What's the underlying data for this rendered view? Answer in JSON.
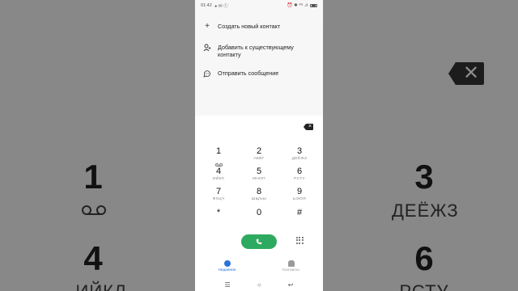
{
  "status_bar": {
    "time": "01:42",
    "left_extra": "▸ ✉ ⓣ",
    "right_icons": "⏰ ✱ ⁴ᴳ .ıl"
  },
  "menu": {
    "items": [
      {
        "label": "Создать новый контакт",
        "icon": "plus-icon"
      },
      {
        "label": "Добавить к существующему контакту",
        "icon": "add-person-icon"
      },
      {
        "label": "Отправить сообщение",
        "icon": "message-icon"
      }
    ]
  },
  "keypad": {
    "keys": [
      {
        "digit": "1",
        "sub": "",
        "voicemail": true
      },
      {
        "digit": "2",
        "sub": "АБВГ"
      },
      {
        "digit": "3",
        "sub": "ДЕЁЖЗ"
      },
      {
        "digit": "4",
        "sub": "ИЙКЛ"
      },
      {
        "digit": "5",
        "sub": "МНОП"
      },
      {
        "digit": "6",
        "sub": "РСТУ"
      },
      {
        "digit": "7",
        "sub": "ФХЦЧ"
      },
      {
        "digit": "8",
        "sub": "ШЩЪЫ"
      },
      {
        "digit": "9",
        "sub": "ЬЭЮЯ"
      },
      {
        "digit": "*",
        "sub": ""
      },
      {
        "digit": "0",
        "sub": ""
      },
      {
        "digit": "#",
        "sub": ""
      }
    ]
  },
  "tabs": {
    "recent": "Недавние",
    "contacts": "Контакты"
  },
  "background": {
    "left_digit_1": "1",
    "left_digit_4": "4",
    "left_sub_4": "ИЙКЛ",
    "right_digit_3": "3",
    "right_sub_3": "ДЕЁЖЗ",
    "right_digit_6": "6",
    "right_sub_6": "РСТУ"
  },
  "colors": {
    "call_green": "#2daa5f",
    "active_tab_blue": "#2a73d8"
  }
}
